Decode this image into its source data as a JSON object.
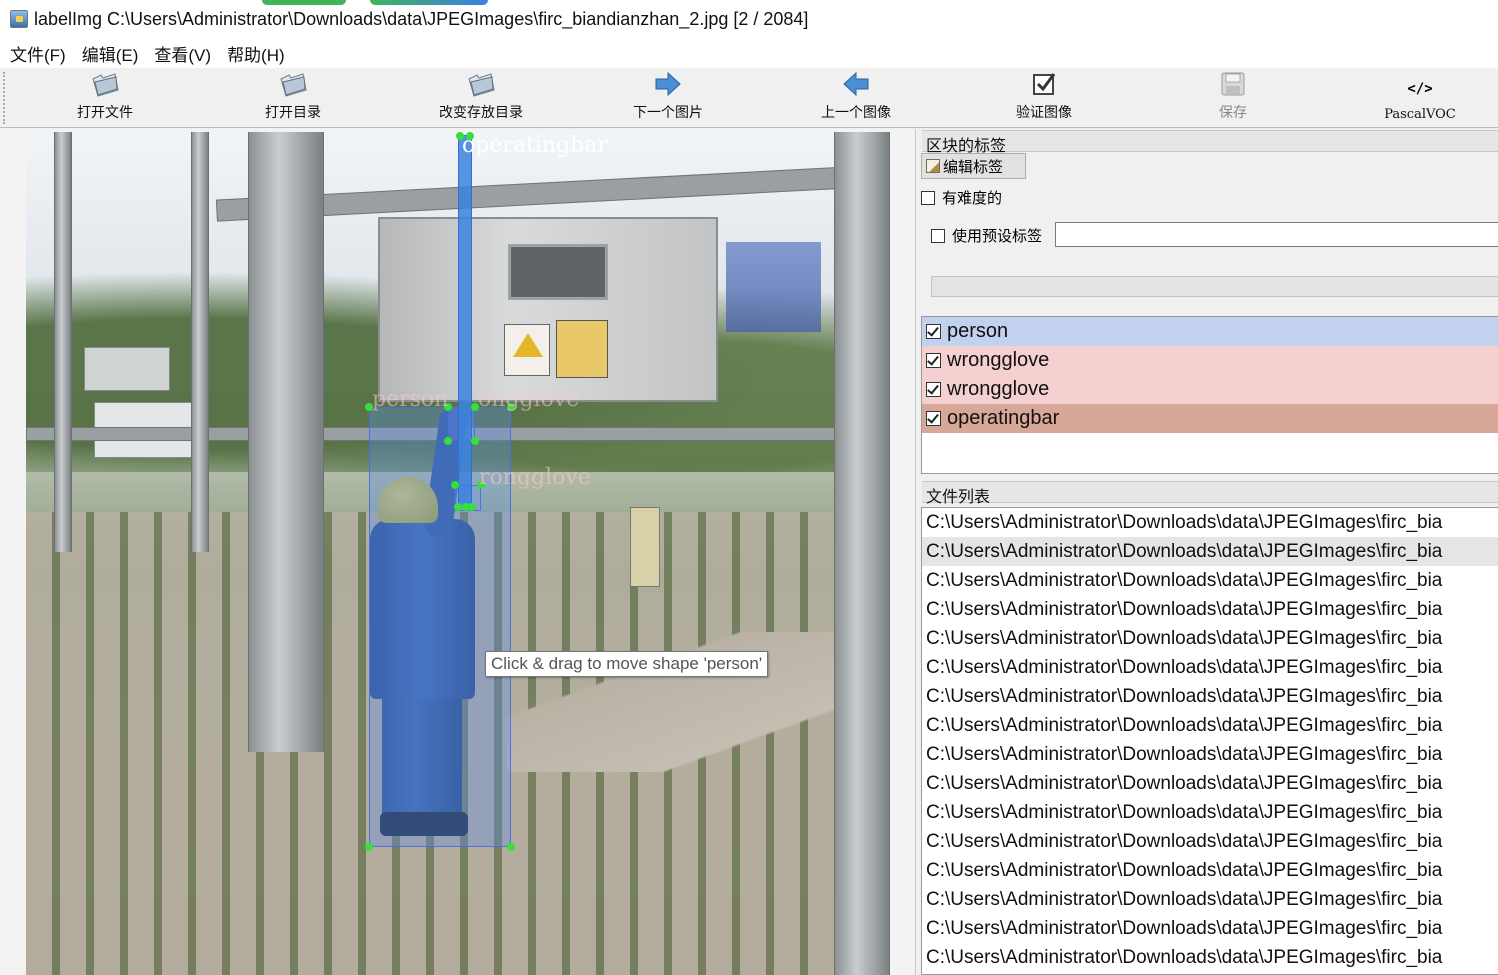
{
  "window": {
    "title": "labelImg C:\\Users\\Administrator\\Downloads\\data\\JPEGImages\\firc_biandianzhan_2.jpg [2 / 2084]"
  },
  "menu": [
    {
      "label": "文件(F)"
    },
    {
      "label": "编辑(E)"
    },
    {
      "label": "查看(V)"
    },
    {
      "label": "帮助(H)"
    }
  ],
  "toolbar": {
    "open_file": "打开文件",
    "open_dir": "打开目录",
    "change_save_dir": "改变存放目录",
    "next_image": "下一个图片",
    "prev_image": "上一个图像",
    "verify": "验证图像",
    "save": "保存",
    "format": "PascalVOC",
    "format_icon_text": "</>"
  },
  "canvas": {
    "shapes": [
      {
        "label": "operatingbar"
      },
      {
        "label": "person"
      },
      {
        "label": "wrongglove"
      },
      {
        "label": "rongglove"
      }
    ],
    "overlay_text": {
      "person_label": "person",
      "wrongglove_label": "ongglove",
      "rongglove_label": "rongglove",
      "operatingbar_label": "operatingbar"
    },
    "tooltip": "Click & drag to move shape 'person'"
  },
  "label_panel": {
    "header": "区块的标签",
    "edit_button": "编辑标签",
    "difficult": "有难度的",
    "use_default_label": "使用预设标签",
    "default_label_value": "",
    "labels": [
      {
        "name": "person",
        "checked": true,
        "color": "#c2d2ee"
      },
      {
        "name": "wrongglove",
        "checked": true,
        "color": "#f5d0d0"
      },
      {
        "name": "wrongglove",
        "checked": true,
        "color": "#f5d0d0"
      },
      {
        "name": "operatingbar",
        "checked": true,
        "color": "#d7a898"
      }
    ]
  },
  "file_panel": {
    "header": "文件列表",
    "files": [
      "C:\\Users\\Administrator\\Downloads\\data\\JPEGImages\\firc_bia",
      "C:\\Users\\Administrator\\Downloads\\data\\JPEGImages\\firc_bia",
      "C:\\Users\\Administrator\\Downloads\\data\\JPEGImages\\firc_bia",
      "C:\\Users\\Administrator\\Downloads\\data\\JPEGImages\\firc_bia",
      "C:\\Users\\Administrator\\Downloads\\data\\JPEGImages\\firc_bia",
      "C:\\Users\\Administrator\\Downloads\\data\\JPEGImages\\firc_bia",
      "C:\\Users\\Administrator\\Downloads\\data\\JPEGImages\\firc_bia",
      "C:\\Users\\Administrator\\Downloads\\data\\JPEGImages\\firc_bia",
      "C:\\Users\\Administrator\\Downloads\\data\\JPEGImages\\firc_bia",
      "C:\\Users\\Administrator\\Downloads\\data\\JPEGImages\\firc_bia",
      "C:\\Users\\Administrator\\Downloads\\data\\JPEGImages\\firc_bia",
      "C:\\Users\\Administrator\\Downloads\\data\\JPEGImages\\firc_bia",
      "C:\\Users\\Administrator\\Downloads\\data\\JPEGImages\\firc_bia",
      "C:\\Users\\Administrator\\Downloads\\data\\JPEGImages\\firc_bia",
      "C:\\Users\\Administrator\\Downloads\\data\\JPEGImages\\firc_bia",
      "C:\\Users\\Administrator\\Downloads\\data\\JPEGImages\\firc_bia"
    ],
    "selected_index": 1
  },
  "icons": {
    "app": "labelimg-app-icon",
    "open": "folder-open-icon",
    "next": "arrow-right-icon",
    "prev": "arrow-left-icon",
    "verify": "checkbox-verify-icon",
    "save": "save-disk-icon",
    "format": "code-tag-icon",
    "edit": "edit-pencil-icon"
  }
}
